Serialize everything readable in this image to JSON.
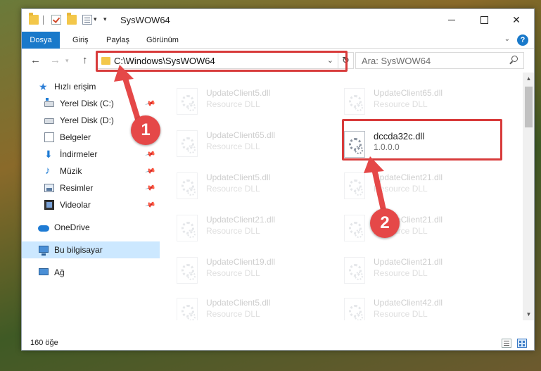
{
  "window": {
    "title": "SysWOW64",
    "controls": {
      "minimize": "minimize",
      "maximize": "maximize",
      "close": "close"
    }
  },
  "ribbon": {
    "tabs": [
      {
        "label": "Dosya",
        "active": true
      },
      {
        "label": "Giriş"
      },
      {
        "label": "Paylaş"
      },
      {
        "label": "Görünüm"
      }
    ],
    "help": "?"
  },
  "address": {
    "path": "C:\\Windows\\SysWOW64",
    "search_placeholder": "Ara: SysWOW64"
  },
  "sidebar": {
    "items": [
      {
        "label": "Hızlı erişim",
        "icon": "star-icon"
      },
      {
        "label": "Yerel Disk (C:)",
        "icon": "drive-icon",
        "pinned": true
      },
      {
        "label": "Yerel Disk (D:)",
        "icon": "drive-icon"
      },
      {
        "label": "Belgeler",
        "icon": "documents-icon",
        "pinned": true
      },
      {
        "label": "İndirmeler",
        "icon": "downloads-icon",
        "pinned": true
      },
      {
        "label": "Müzik",
        "icon": "music-icon",
        "pinned": true
      },
      {
        "label": "Resimler",
        "icon": "pictures-icon",
        "pinned": true
      },
      {
        "label": "Videolar",
        "icon": "videos-icon",
        "pinned": true
      },
      {
        "label": "OneDrive",
        "icon": "cloud-icon"
      },
      {
        "label": "Bu bilgisayar",
        "icon": "computer-icon",
        "selected": true
      },
      {
        "label": "Ağ",
        "icon": "network-icon"
      }
    ]
  },
  "files": {
    "highlighted": {
      "name": "dccda32c.dll",
      "version": "1.0.0.0"
    },
    "left": [
      {
        "name": "UpdateClient5.dll",
        "type": "Resource DLL"
      },
      {
        "name": "UpdateClient65.dll",
        "type": "Resource DLL"
      },
      {
        "name": "UpdateClient5.dll",
        "type": "Resource DLL"
      },
      {
        "name": "UpdateClient21.dll",
        "type": "Resource DLL"
      },
      {
        "name": "UpdateClient19.dll",
        "type": "Resource DLL"
      },
      {
        "name": "UpdateClient5.dll",
        "type": "Resource DLL"
      }
    ],
    "right": [
      {
        "name": "UpdateClient65.dll",
        "type": "Resource DLL"
      },
      {
        "name": "UpdateClient21.dll",
        "type": "Resource DLL"
      },
      {
        "name": "UpdateClient21.dll",
        "type": "Resource DLL"
      },
      {
        "name": "UpdateClient21.dll",
        "type": "Resource DLL"
      },
      {
        "name": "UpdateClient42.dll",
        "type": "Resource DLL"
      }
    ]
  },
  "callouts": {
    "step1": "1",
    "step2": "2",
    "color": "#d83b3b"
  },
  "status": {
    "item_count": "160 öğe"
  },
  "colors": {
    "accent": "#1979ca",
    "selected_bg": "#cce8ff"
  }
}
